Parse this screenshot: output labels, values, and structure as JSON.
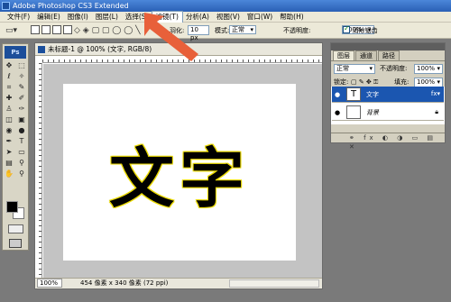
{
  "window": {
    "title": "Adobe Photoshop CS3 Extended"
  },
  "menu": [
    {
      "label": "文件(F)"
    },
    {
      "label": "编辑(E)"
    },
    {
      "label": "图像(I)"
    },
    {
      "label": "图层(L)"
    },
    {
      "label": "选择(S)"
    },
    {
      "label": "滤镜(T)"
    },
    {
      "label": "分析(A)"
    },
    {
      "label": "视图(V)"
    },
    {
      "label": "窗口(W)"
    },
    {
      "label": "帮助(H)"
    }
  ],
  "options": {
    "feather_label": "羽化:",
    "feather_value": "10 px",
    "mode_label": "模式:",
    "mode_value": "正常",
    "opacity_label": "不透明度:",
    "opacity_value": "100%",
    "antialias_label": "消除锯齿"
  },
  "toolbox": {
    "logo": "Ps"
  },
  "document": {
    "title": "未标题-1 @ 100% (文字, RGB/8)",
    "canvas_text": "文字",
    "zoom": "100%",
    "doc_info": "454 像素 x 340 像素 (72 ppi)"
  },
  "layers_panel": {
    "tabs": [
      "图层",
      "通道",
      "路径"
    ],
    "blend_mode": "正常",
    "opacity_label": "不透明度:",
    "opacity_value": "100%",
    "lock_label": "锁定:",
    "fill_label": "填充:",
    "fill_value": "100%",
    "layers": [
      {
        "name": "文字",
        "thumb": "T",
        "selected": true
      },
      {
        "name": "背景",
        "thumb": "",
        "selected": false
      }
    ]
  },
  "colors": {
    "accent_arrow": "#e8603a",
    "text_outline": "#f2e000",
    "selected_layer": "#1b56b0"
  }
}
